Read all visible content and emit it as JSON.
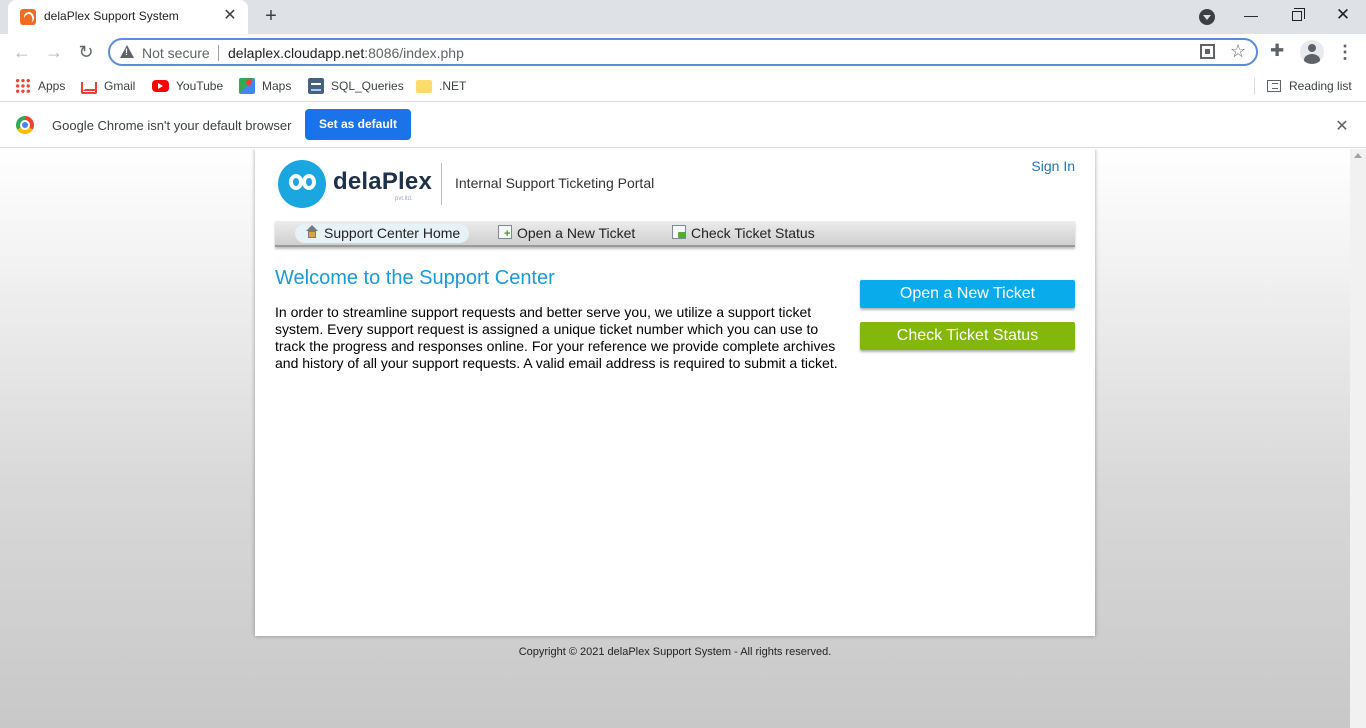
{
  "browser": {
    "tab_title": "delaPlex Support System",
    "tab_close": "✕",
    "new_tab": "+",
    "security_label": "Not secure",
    "url_host": "delaplex.cloudapp.net",
    "url_rest": ":8086/index.php",
    "bookmarks": [
      {
        "label": "Apps",
        "icon": "apps-grid-icon"
      },
      {
        "label": "Gmail",
        "icon": "gmail-icon"
      },
      {
        "label": "YouTube",
        "icon": "youtube-icon"
      },
      {
        "label": "Maps",
        "icon": "maps-icon"
      },
      {
        "label": "SQL_Queries",
        "icon": "sql-icon"
      },
      {
        "label": ".NET",
        "icon": "folder-icon"
      }
    ],
    "reading_list": "Reading list",
    "infobar_message": "Google Chrome isn't your default browser",
    "infobar_button": "Set as default",
    "accent_color": "#1a73e8"
  },
  "page": {
    "brand": "delaPlex",
    "brand_sub": "pvt.ltd.",
    "portal_name": "Internal Support Ticketing Portal",
    "sign_in": "Sign In",
    "nav": [
      {
        "label": "Support Center Home",
        "icon": "home-icon",
        "active": true
      },
      {
        "label": "Open a New Ticket",
        "icon": "new-ticket-icon",
        "active": false
      },
      {
        "label": "Check Ticket Status",
        "icon": "ticket-status-icon",
        "active": false
      }
    ],
    "welcome_title": "Welcome to the Support Center",
    "intro_text": "In order to streamline support requests and better serve you, we utilize a support ticket system. Every support request is assigned a unique ticket number which you can use to track the progress and responses online. For your reference we provide complete archives and history of all your support requests. A valid email address is required to submit a ticket.",
    "open_ticket_button": "Open a New Ticket",
    "check_status_button": "Check Ticket Status",
    "copyright": "Copyright © 2021 delaPlex Support System - All rights reserved.",
    "colors": {
      "title_blue": "#1a9ad6",
      "open_button": "#0aabea",
      "check_button": "#83b70b",
      "link": "#1c75bc"
    }
  }
}
